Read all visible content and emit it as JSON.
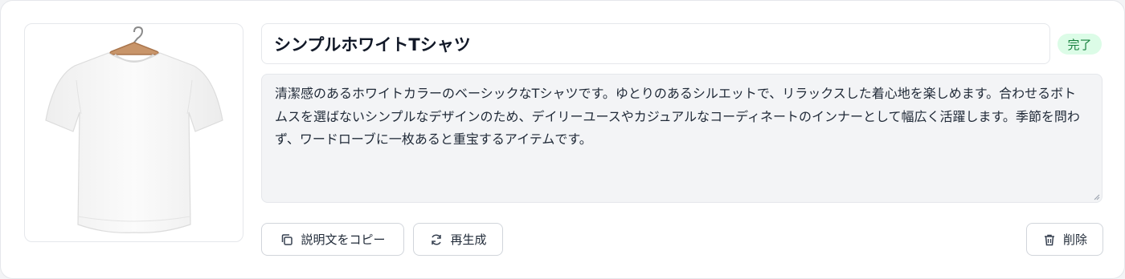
{
  "product": {
    "title": "シンプルホワイトTシャツ",
    "status": "完了",
    "description": "清潔感のあるホワイトカラーのベーシックなTシャツです。ゆとりのあるシルエットで、リラックスした着心地を楽しめます。合わせるボトムスを選ばないシンプルなデザインのため、デイリーユースやカジュアルなコーディネートのインナーとして幅広く活躍します。季節を問わず、ワードローブに一枚あると重宝するアイテムです。",
    "image_icon": "white-tshirt-on-hanger"
  },
  "actions": {
    "copy_label": "説明文をコピー",
    "copy_icon": "copy-icon",
    "regenerate_label": "再生成",
    "regenerate_icon": "refresh-icon",
    "delete_label": "削除",
    "delete_icon": "trash-icon"
  },
  "colors": {
    "status_bg": "#dcfce7",
    "status_text": "#15803d",
    "textarea_bg": "#f3f4f6",
    "border": "#e5e7eb"
  }
}
